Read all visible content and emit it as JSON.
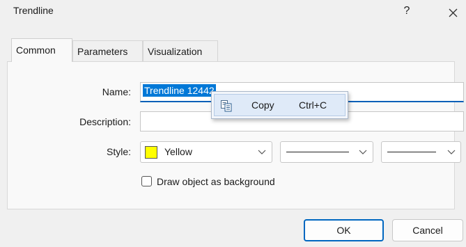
{
  "dialog": {
    "title": "Trendline",
    "help_label": "?"
  },
  "tabs": [
    {
      "label": "Common",
      "active": true
    },
    {
      "label": "Parameters",
      "active": false
    },
    {
      "label": "Visualization",
      "active": false
    }
  ],
  "form": {
    "name_label": "Name:",
    "name_value": "Trendline 12442",
    "description_label": "Description:",
    "description_value": "",
    "style_label": "Style:",
    "color_name": "Yellow",
    "color_hex": "#ffff00",
    "background_checkbox_label": "Draw object as background",
    "background_checked": false
  },
  "context_menu": {
    "items": [
      {
        "label": "Copy",
        "shortcut": "Ctrl+C",
        "icon": "copy-icon"
      }
    ]
  },
  "buttons": {
    "ok_label": "OK",
    "cancel_label": "Cancel"
  },
  "colors": {
    "accent": "#0078d7",
    "focus_border": "#005fb8",
    "menu_highlight": "#dfeaf8"
  }
}
